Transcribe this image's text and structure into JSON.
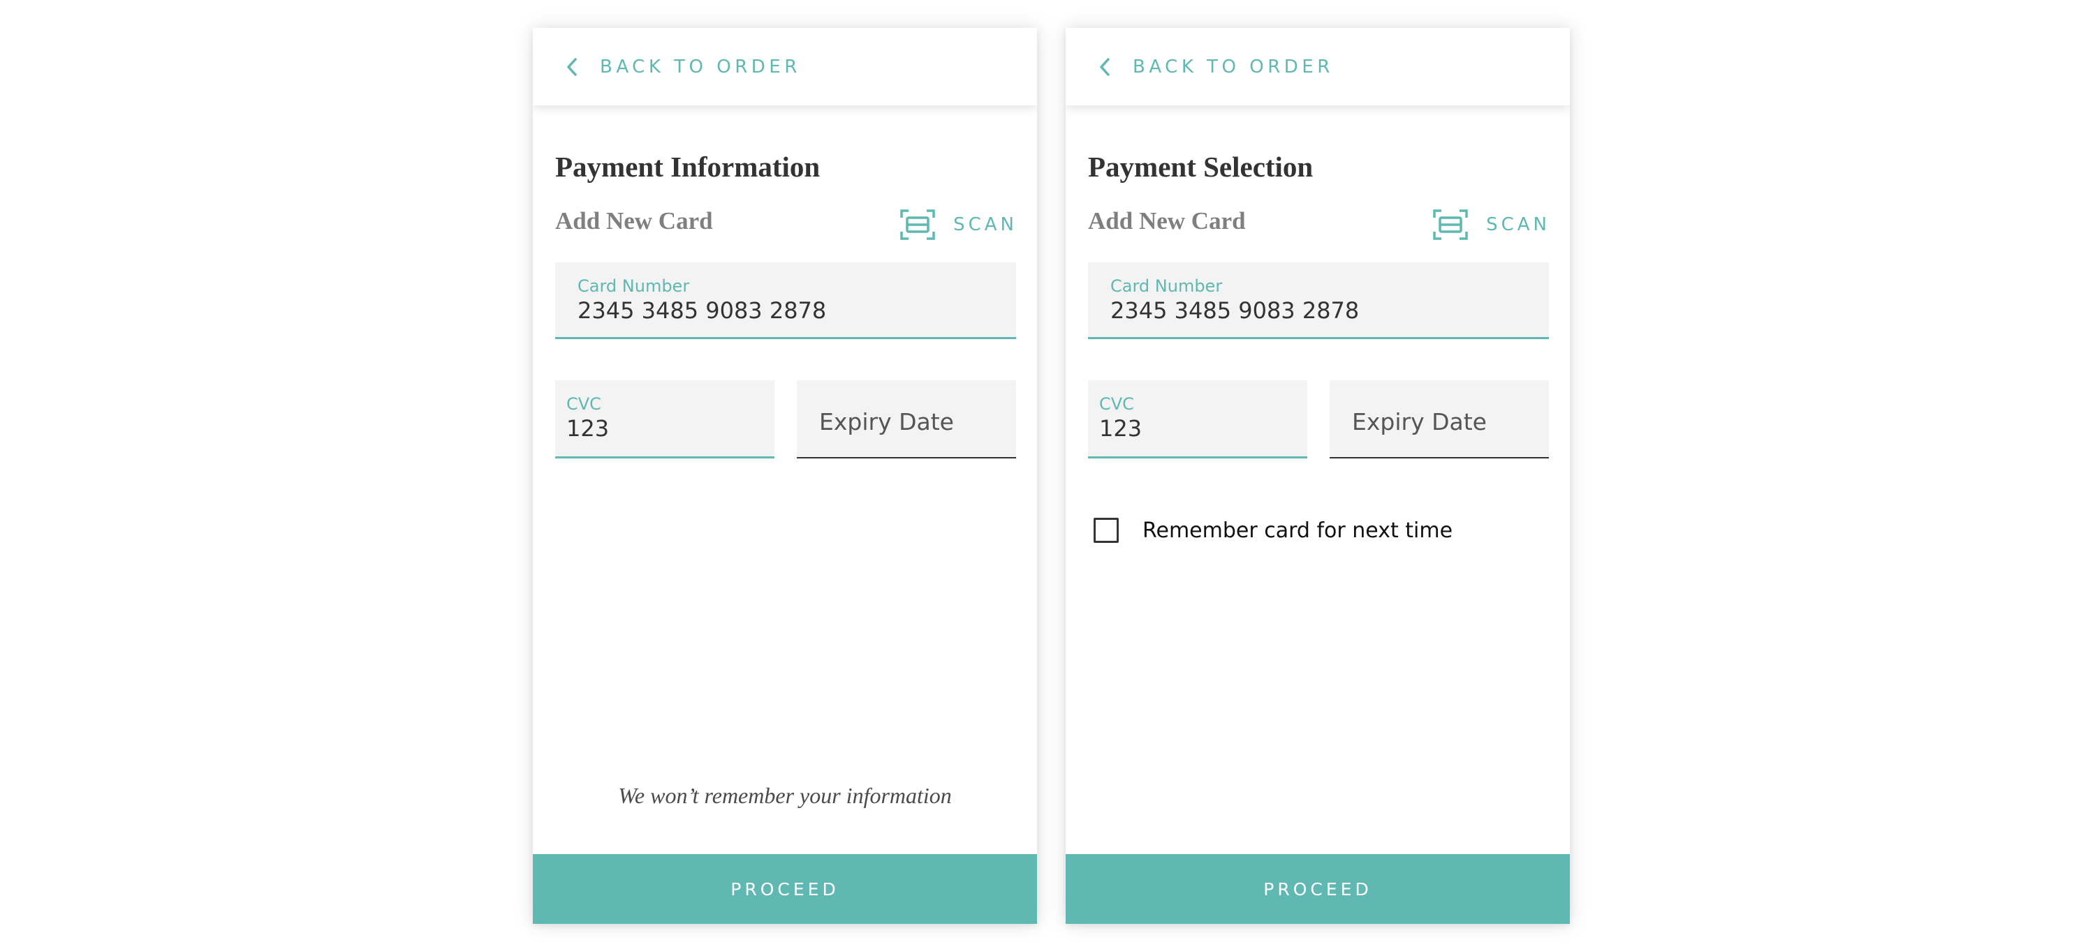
{
  "colors": {
    "accent": "#5fb8b1",
    "field_bg": "#f3f3f3",
    "text_dark": "#333333",
    "text_muted": "#7f7f7f"
  },
  "screens": [
    {
      "back_label": "BACK TO ORDER",
      "title": "Payment Information",
      "subtitle": "Add New Card",
      "scan_label": "SCAN",
      "card_number": {
        "label": "Card Number",
        "value": "2345 3485 9083 2878"
      },
      "cvc": {
        "label": "CVC",
        "value": "123"
      },
      "expiry": {
        "placeholder": "Expiry Date"
      },
      "note": "We won’t remember your information",
      "proceed_label": "PROCEED"
    },
    {
      "back_label": "BACK TO ORDER",
      "title": "Payment Selection",
      "subtitle": "Add New Card",
      "scan_label": "SCAN",
      "card_number": {
        "label": "Card Number",
        "value": "2345 3485 9083 2878"
      },
      "cvc": {
        "label": "CVC",
        "value": "123"
      },
      "expiry": {
        "placeholder": "Expiry Date"
      },
      "remember": {
        "label": "Remember card for next time",
        "checked": false
      },
      "proceed_label": "PROCEED"
    }
  ],
  "icons": {
    "back": "chevron-left-icon",
    "scan": "scan-card-icon",
    "checkbox": "checkbox-unchecked-icon"
  }
}
